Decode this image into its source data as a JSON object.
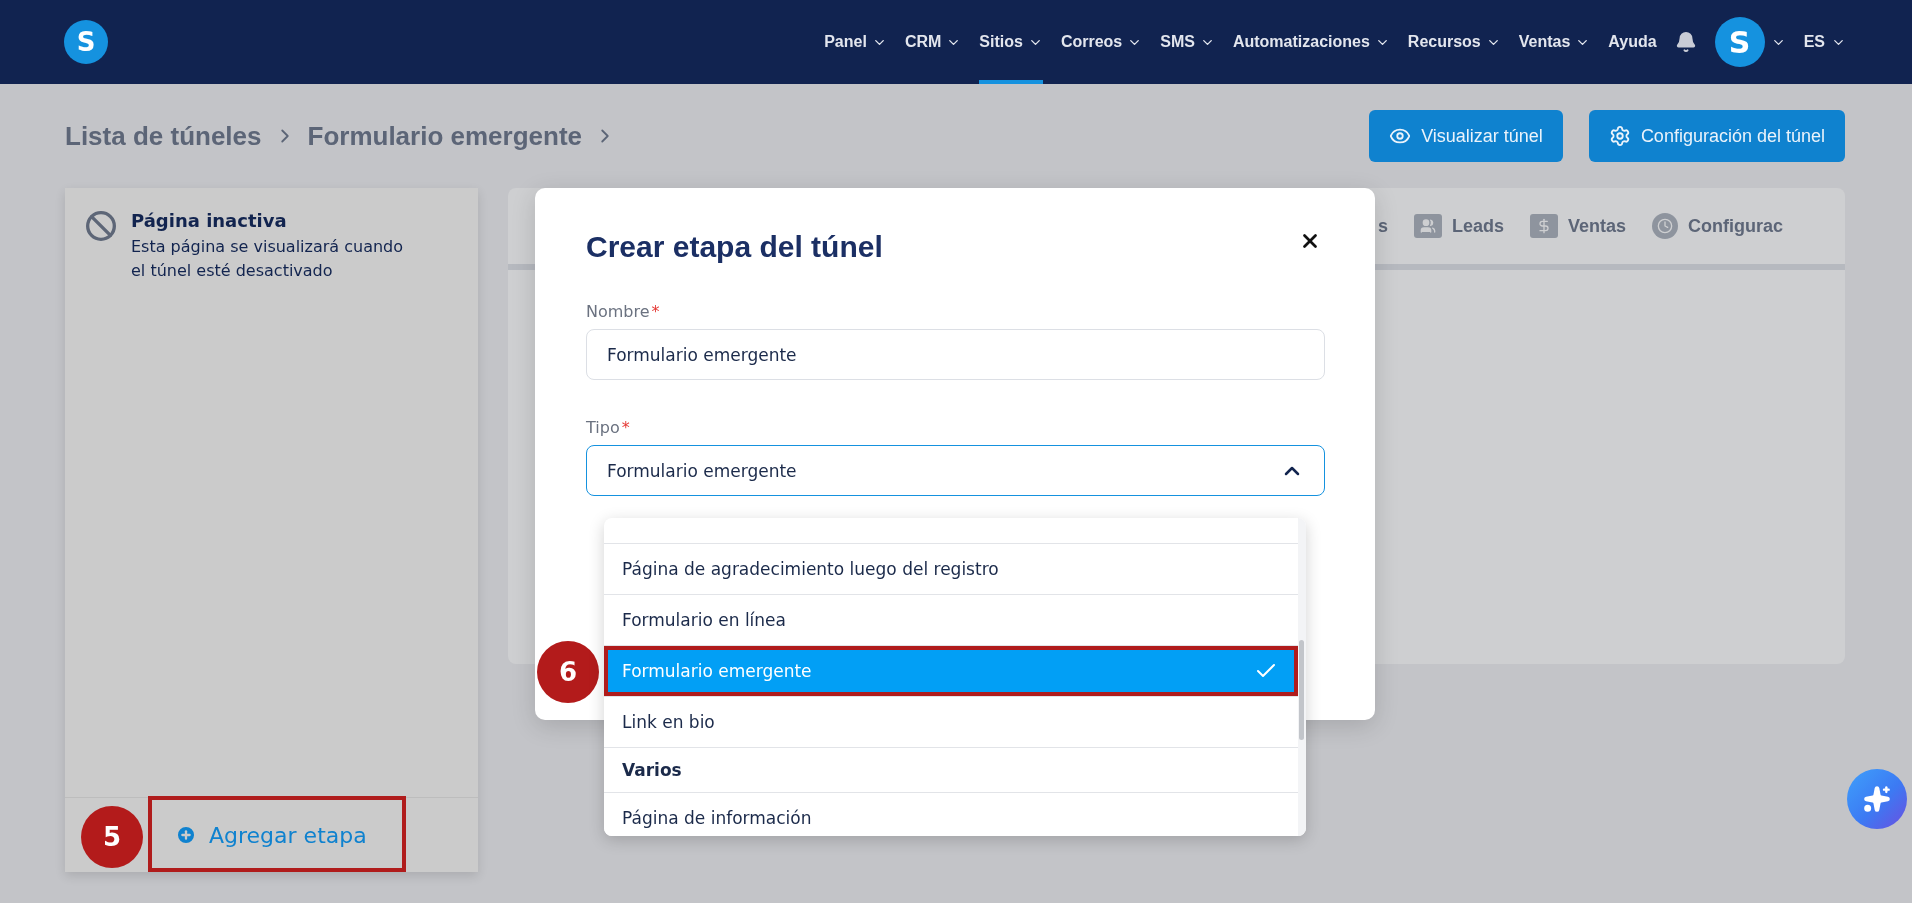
{
  "nav": {
    "logo": "S",
    "items": [
      {
        "label": "Panel",
        "dropdown": true,
        "selected": false
      },
      {
        "label": "CRM",
        "dropdown": true,
        "selected": false
      },
      {
        "label": "Sitios",
        "dropdown": true,
        "selected": true
      },
      {
        "label": "Correos",
        "dropdown": true,
        "selected": false
      },
      {
        "label": "SMS",
        "dropdown": true,
        "selected": false
      },
      {
        "label": "Automatizaciones",
        "dropdown": true,
        "selected": false
      },
      {
        "label": "Recursos",
        "dropdown": true,
        "selected": false
      },
      {
        "label": "Ventas",
        "dropdown": true,
        "selected": false
      },
      {
        "label": "Ayuda",
        "dropdown": false,
        "selected": false
      }
    ],
    "avatar": "S",
    "language": "ES"
  },
  "breadcrumb": [
    "Lista de túneles",
    "Formulario emergente"
  ],
  "header_buttons": [
    {
      "label": "Visualizar túnel",
      "kind": "eye"
    },
    {
      "label": "Configuración del túnel",
      "kind": "gear"
    }
  ],
  "sidebar": {
    "items": [
      {
        "title": "Página inactiva",
        "description": "Esta página se visualizará cuando el túnel esté desactivado"
      }
    ],
    "add_button": "Agregar etapa"
  },
  "tabs": [
    {
      "label": "s",
      "kind": "plain"
    },
    {
      "label": "Leads",
      "kind": "people"
    },
    {
      "label": "Ventas",
      "kind": "dollar"
    },
    {
      "label": "Configurac",
      "kind": "clock"
    }
  ],
  "modal": {
    "title": "Crear etapa del túnel",
    "fields": [
      {
        "label": "Nombre",
        "required_mark": "*",
        "value": "Formulario emergente",
        "kind": "text"
      },
      {
        "label": "Tipo",
        "required_mark": "*",
        "value": "Formulario emergente",
        "kind": "select",
        "expanded": true
      }
    ]
  },
  "dropdown": {
    "options": [
      {
        "label": "Página de agradecimiento luego del registro",
        "kind": "option",
        "selected": false
      },
      {
        "label": "Formulario en línea",
        "kind": "option",
        "selected": false
      },
      {
        "label": "Formulario emergente",
        "kind": "option",
        "selected": true
      },
      {
        "label": "Link en bio",
        "kind": "option",
        "selected": false
      },
      {
        "label": "Varios",
        "kind": "group"
      },
      {
        "label": "Página de información",
        "kind": "option",
        "selected": false
      }
    ]
  },
  "annotations": [
    {
      "number": "5"
    },
    {
      "number": "6"
    }
  ]
}
